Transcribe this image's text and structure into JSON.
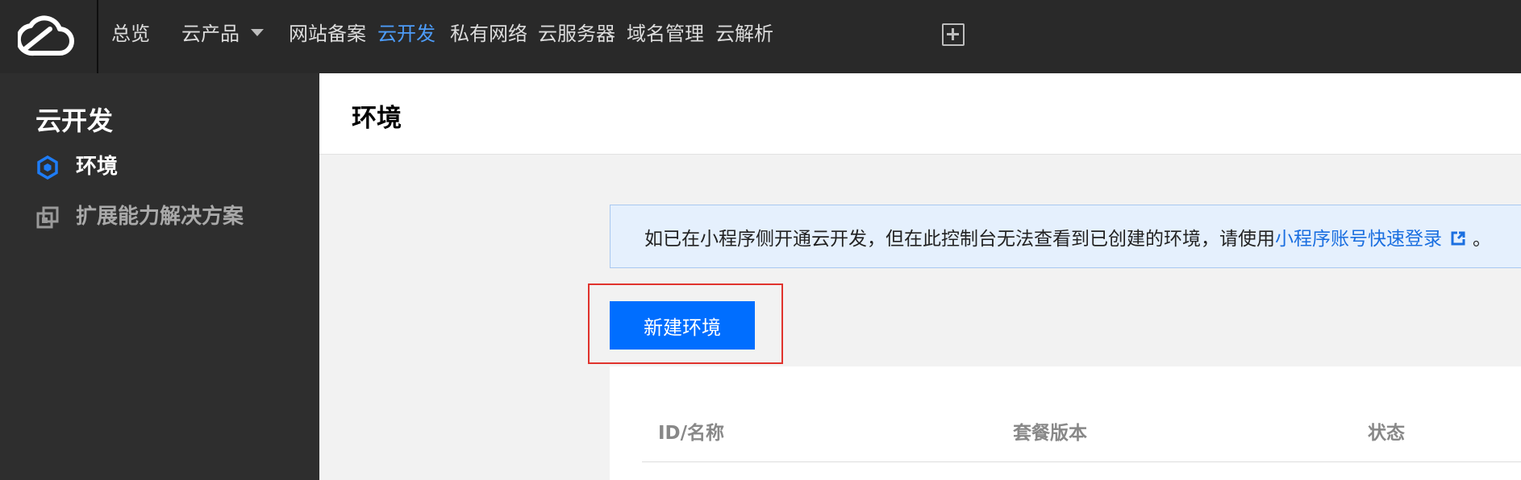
{
  "topbar": {
    "nav": [
      {
        "label": "总览"
      },
      {
        "label": "云产品"
      },
      {
        "label": "网站备案"
      },
      {
        "label": "云开发"
      },
      {
        "label": "私有网络"
      },
      {
        "label": "云服务器"
      },
      {
        "label": "域名管理"
      },
      {
        "label": "云解析"
      }
    ],
    "icons": {
      "logo": "cloud-logo-icon",
      "dropdown": "caret-down-icon",
      "add": "add-square-icon"
    },
    "active_color": "#4d9cf8"
  },
  "sidebar": {
    "title": "云开发",
    "items": [
      {
        "label": "环境",
        "icon": "hexagon-icon",
        "active": true
      },
      {
        "label": "扩展能力解决方案",
        "icon": "extension-icon",
        "active": false
      }
    ]
  },
  "main": {
    "title": "环境",
    "notice": {
      "text": "如已在小程序侧开通云开发，但在此控制台无法查看到已创建的环境，请使用",
      "link_text": "小程序账号快速登录",
      "link_icon": "external-link-icon",
      "suffix": "。"
    },
    "create_button": "新建环境",
    "table": {
      "columns": [
        "ID/名称",
        "套餐版本",
        "状态"
      ]
    }
  },
  "colors": {
    "primary": "#006eff",
    "link": "#1b6fe0",
    "highlight": "#e0332d",
    "topbar_bg": "#292929",
    "sidebar_bg": "#2e2e2e"
  }
}
